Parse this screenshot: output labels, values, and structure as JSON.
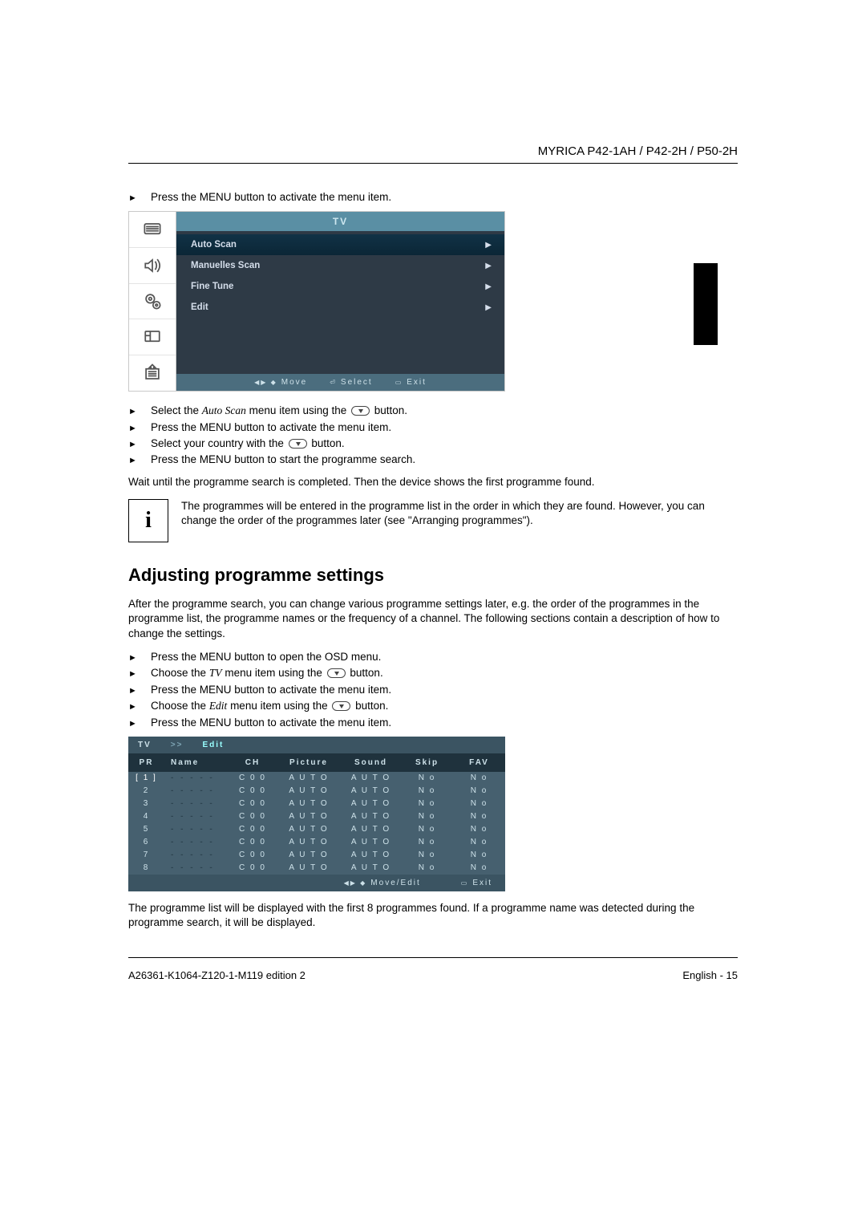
{
  "header": {
    "title": "MYRICA P42-1AH / P42-2H / P50-2H"
  },
  "steps_before": [
    "Press the MENU button to activate the menu item."
  ],
  "osd1": {
    "title": "TV",
    "items": [
      {
        "label": "Auto Scan",
        "highlight": true
      },
      {
        "label": "Manuelles Scan",
        "highlight": false
      },
      {
        "label": "Fine Tune",
        "highlight": false
      },
      {
        "label": "Edit",
        "highlight": false
      }
    ],
    "footer": {
      "move": "Move",
      "select": "Select",
      "exit": "Exit"
    }
  },
  "steps_after_osd1": [
    {
      "pre": "Select the ",
      "em": "Auto Scan",
      "mid": " menu item using the ",
      "btn": "down",
      "post": " button."
    },
    {
      "text": "Press the MENU button to activate the menu item."
    },
    {
      "pre": "Select your country with the ",
      "btn": "down",
      "post": " button."
    },
    {
      "text": "Press the MENU button to start the programme search."
    }
  ],
  "wait_line": "Wait until the programme search is completed. Then the device shows the first programme found.",
  "info": "The programmes will be entered in the programme list in the order in which they are found. However, you can change the order of the programmes later (see \"Arranging programmes\").",
  "h2": "Adjusting programme settings",
  "para2": "After the programme search, you can change various programme settings later, e.g. the order of the programmes in the programme list, the programme names or the frequency of a channel. The following sections contain a description of how to change the settings.",
  "steps2": [
    {
      "text": "Press the MENU button to open the OSD menu."
    },
    {
      "pre": "Choose the ",
      "em": "TV",
      "mid": " menu item using the ",
      "btn": "down",
      "post": " button."
    },
    {
      "text": "Press the MENU button to activate the menu item."
    },
    {
      "pre": "Choose the ",
      "em": "Edit",
      "mid": " menu item using the ",
      "btn": "down",
      "post": " button."
    },
    {
      "text": "Press the MENU button to activate the menu item."
    }
  ],
  "osd2": {
    "crumb_tv": "TV",
    "crumb_sep": ">>",
    "crumb_edit": "Edit",
    "headers": [
      "PR",
      "Name",
      "CH",
      "Picture",
      "Sound",
      "Skip",
      "FAV"
    ],
    "rows": [
      {
        "pr": "[ 1 ]",
        "name": "- - - - -",
        "ch": "C 0 0",
        "picture": "A U T O",
        "sound": "A U T O",
        "skip": "N o",
        "fav": "N o"
      },
      {
        "pr": "2",
        "name": "- - - - -",
        "ch": "C 0 0",
        "picture": "A U T O",
        "sound": "A U T O",
        "skip": "N o",
        "fav": "N o"
      },
      {
        "pr": "3",
        "name": "- - - - -",
        "ch": "C 0 0",
        "picture": "A U T O",
        "sound": "A U T O",
        "skip": "N o",
        "fav": "N o"
      },
      {
        "pr": "4",
        "name": "- - - - -",
        "ch": "C 0 0",
        "picture": "A U T O",
        "sound": "A U T O",
        "skip": "N o",
        "fav": "N o"
      },
      {
        "pr": "5",
        "name": "- - - - -",
        "ch": "C 0 0",
        "picture": "A U T O",
        "sound": "A U T O",
        "skip": "N o",
        "fav": "N o"
      },
      {
        "pr": "6",
        "name": "- - - - -",
        "ch": "C 0 0",
        "picture": "A U T O",
        "sound": "A U T O",
        "skip": "N o",
        "fav": "N o"
      },
      {
        "pr": "7",
        "name": "- - - - -",
        "ch": "C 0 0",
        "picture": "A U T O",
        "sound": "A U T O",
        "skip": "N o",
        "fav": "N o"
      },
      {
        "pr": "8",
        "name": "- - - - -",
        "ch": "C 0 0",
        "picture": "A U T O",
        "sound": "A U T O",
        "skip": "N o",
        "fav": "N o"
      }
    ],
    "footer": {
      "move": "Move/Edit",
      "exit": "Exit"
    }
  },
  "para3": "The programme list will be displayed with the first 8 programmes found. If a programme name was detected during the programme search, it will be displayed.",
  "footer": {
    "left": "A26361-K1064-Z120-1-M119 edition 2",
    "right": "English - 15"
  }
}
